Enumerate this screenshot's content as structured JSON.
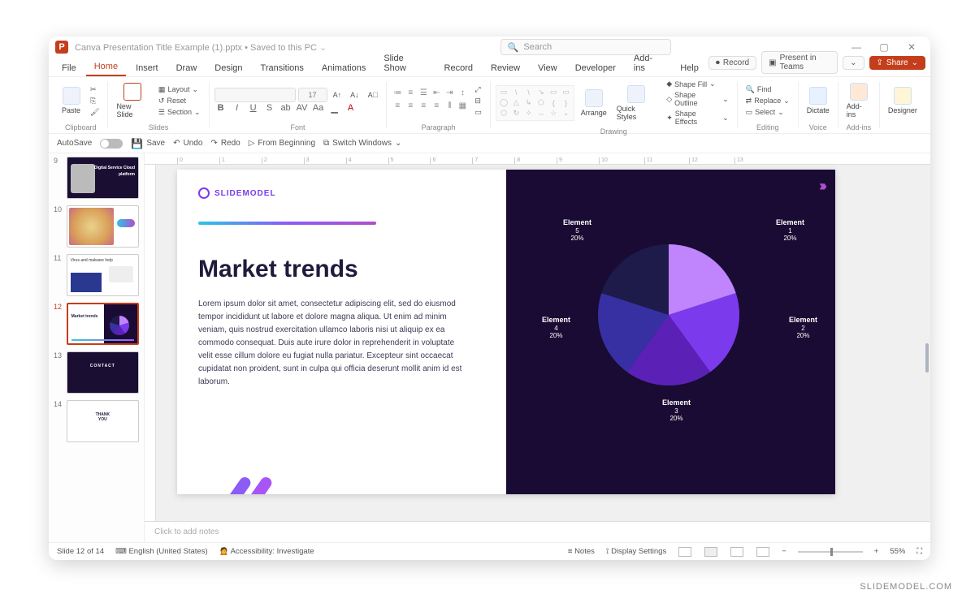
{
  "title": {
    "doc": "Canva Presentation Title Example (1).pptx",
    "saved": "Saved to this PC",
    "search_placeholder": "Search"
  },
  "win": {
    "min": "—",
    "max": "▢",
    "close": "✕"
  },
  "tabs": {
    "file": "File",
    "home": "Home",
    "insert": "Insert",
    "draw": "Draw",
    "design": "Design",
    "transitions": "Transitions",
    "animations": "Animations",
    "slideshow": "Slide Show",
    "record": "Record",
    "review": "Review",
    "view": "View",
    "developer": "Developer",
    "addins": "Add-ins",
    "help": "Help",
    "rec_btn": "Record",
    "present_teams": "Present in Teams",
    "share": "Share"
  },
  "ribbon": {
    "paste": "Paste",
    "newslide": "New Slide",
    "layout": "Layout",
    "reset": "Reset",
    "section": "Section",
    "font_size": "17",
    "B": "B",
    "I": "I",
    "U": "U",
    "S": "S",
    "ab": "ab",
    "AV": "AV",
    "Aa": "Aa",
    "Ac": "A",
    "arrange": "Arrange",
    "quickstyles": "Quick Styles",
    "shapefill": "Shape Fill",
    "shapeoutline": "Shape Outline",
    "shapeeffects": "Shape Effects",
    "find": "Find",
    "replace": "Replace",
    "select": "Select",
    "dictate": "Dictate",
    "addins_btn": "Add-ins",
    "designer": "Designer",
    "g_clipboard": "Clipboard",
    "g_slides": "Slides",
    "g_font": "Font",
    "g_paragraph": "Paragraph",
    "g_drawing": "Drawing",
    "g_editing": "Editing",
    "g_voice": "Voice",
    "g_addins": "Add-ins"
  },
  "qat": {
    "autosave": "AutoSave",
    "save": "Save",
    "undo": "Undo",
    "redo": "Redo",
    "frombeginning": "From Beginning",
    "switchwindows": "Switch Windows"
  },
  "thumbs": {
    "n9": "9",
    "t9a": "Digital Service Cloud",
    "t9b": "platform",
    "n10": "10",
    "n11": "11",
    "t11": "Virus and malware help",
    "n12": "12",
    "t12": "Market trends",
    "n13": "13",
    "t13": "CONTACT",
    "n14": "14",
    "t14a": "THANK",
    "t14b": "YOU"
  },
  "slide": {
    "brand": "SLIDEMODEL",
    "title": "Market trends",
    "body": "Lorem ipsum dolor sit amet, consectetur adipiscing elit, sed do eiusmod tempor incididunt ut labore et dolore magna aliqua. Ut enim ad minim veniam, quis nostrud exercitation ullamco laboris nisi ut aliquip ex ea commodo consequat. Duis aute irure dolor in reprehenderit in voluptate velit esse cillum dolore eu fugiat nulla pariatur. Excepteur sint occaecat cupidatat non proident, sunt in culpa qui officia deserunt mollit anim id est laborum.",
    "chev": "›››",
    "labels": {
      "e1": "Element",
      "n1": "1",
      "p1": "20%",
      "e2": "Element",
      "n2": "2",
      "p2": "20%",
      "e3": "Element",
      "n3": "3",
      "p3": "20%",
      "e4": "Element",
      "n4": "4",
      "p4": "20%",
      "e5": "Element",
      "n5": "5",
      "p5": "20%"
    }
  },
  "ruler": {
    "r0": "0",
    "r1": "1",
    "r2": "2",
    "r3": "3",
    "r4": "4",
    "r5": "5",
    "r6": "6",
    "r7": "7",
    "r8": "8",
    "r9": "9",
    "r10": "10",
    "r11": "11",
    "r12": "12",
    "r13": "13"
  },
  "notes": {
    "placeholder": "Click to add notes"
  },
  "status": {
    "slide": "Slide 12 of 14",
    "lang": "English (United States)",
    "acc": "Accessibility: Investigate",
    "notes": "Notes",
    "display": "Display Settings",
    "zoom": "55%"
  },
  "watermark": "SLIDEMODEL.COM",
  "chart_data": {
    "type": "pie",
    "title": "Market trends",
    "categories": [
      "Element 1",
      "Element 2",
      "Element 3",
      "Element 4",
      "Element 5"
    ],
    "values": [
      20,
      20,
      20,
      20,
      20
    ],
    "colors": [
      "#c084fc",
      "#7c3aed",
      "#5b21b6",
      "#3730a3",
      "#1e1b4b"
    ]
  }
}
